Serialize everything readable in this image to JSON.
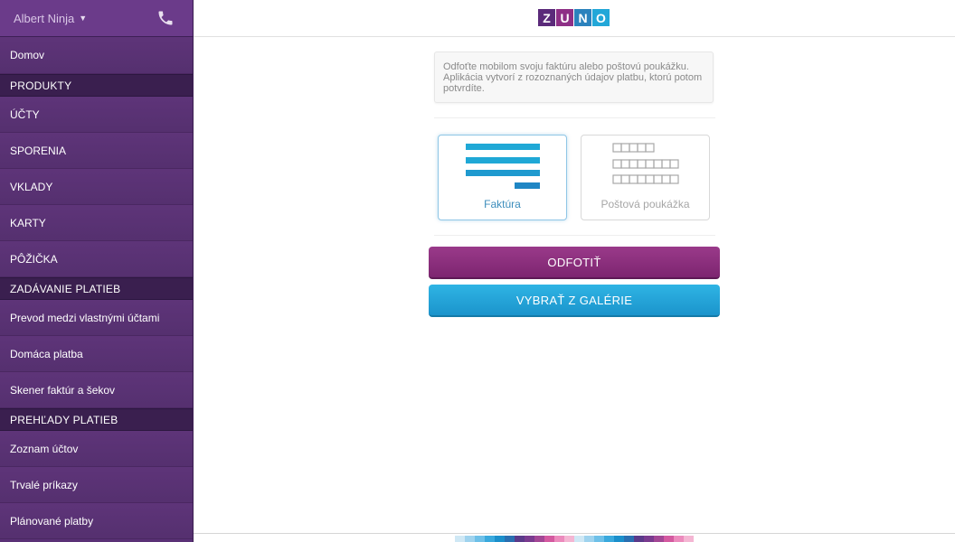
{
  "sidebar": {
    "user_name": "Albert Ninja",
    "items": {
      "home": "Domov",
      "products_header": "PRODUKTY",
      "accounts": "ÚČTY",
      "savings": "SPORENIA",
      "deposits": "VKLADY",
      "cards": "KARTY",
      "loan": "PÔŽIČKA",
      "payments_header": "ZADÁVANIE PLATIEB",
      "own_transfer": "Prevod medzi vlastnými účtami",
      "domestic_payment": "Domáca platba",
      "invoice_scanner": "Skener faktúr a šekov",
      "overview_header": "PREHĽADY PLATIEB",
      "account_list": "Zoznam účtov",
      "standing_orders": "Trvalé príkazy",
      "planned_payments": "Plánované platby"
    }
  },
  "header": {
    "logo": [
      "Z",
      "U",
      "N",
      "O"
    ],
    "logo_colors": [
      "#5b2a7a",
      "#8e2f86",
      "#2b82bd",
      "#22a7d8"
    ]
  },
  "main": {
    "info_text": "Odfoťte mobilom svoju faktúru alebo poštovú poukážku. Aplikácia vytvorí z rozoznaných údajov platbu, ktorú potom potvrdíte.",
    "options": {
      "invoice": "Faktúra",
      "postal": "Poštová poukážka"
    },
    "buttons": {
      "photo": "ODFOTIŤ",
      "gallery": "VYBRAŤ Z GALÉRIE"
    }
  },
  "accent_colors": {
    "sidebar": "#5a3176",
    "photo_button": "#8b2f7e",
    "gallery_button": "#22a5dc",
    "invoice_icon": "#1ea3d4"
  },
  "footer_strip_colors": [
    "#cfe8f5",
    "#9fd3ee",
    "#6ec0e8",
    "#3aa9dd",
    "#1b8fcb",
    "#2a6fb1",
    "#5b3a8a",
    "#7a3b8f",
    "#a34795",
    "#d45aa0",
    "#ec8bbd",
    "#f4b6d3",
    "#cfe8f5",
    "#9fd3ee",
    "#6ec0e8",
    "#3aa9dd",
    "#1b8fcb",
    "#2a6fb1",
    "#5b3a8a",
    "#7a3b8f",
    "#a34795",
    "#d45aa0",
    "#ec8bbd",
    "#f4b6d3"
  ]
}
